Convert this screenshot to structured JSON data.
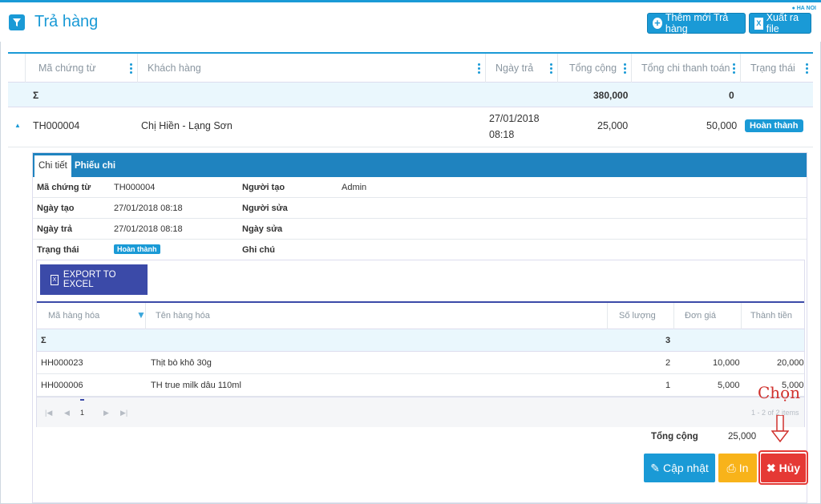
{
  "header": {
    "title": "Trả hàng",
    "location": "HA NOI",
    "add_button": "Thêm mới Trả hàng",
    "export_button": "Xuất ra file"
  },
  "grid": {
    "columns": [
      "Mã chứng từ",
      "Khách hàng",
      "Ngày trả",
      "Tổng cộng",
      "Tổng chi thanh toán",
      "Trạng thái"
    ],
    "summary": {
      "symbol": "Σ",
      "total": "380,000",
      "paid": "0"
    },
    "row": {
      "code": "TH000004",
      "customer": "Chị Hiền - Lạng Sơn",
      "date": "27/01/2018",
      "time": "08:18",
      "total": "25,000",
      "paid": "50,000",
      "status": "Hoàn thành"
    }
  },
  "detail": {
    "tabs": [
      "Chi tiết",
      "Phiếu chi"
    ],
    "info": {
      "code_label": "Mã chứng từ",
      "code": "TH000004",
      "creator_label": "Người tạo",
      "creator": "Admin",
      "created_label": "Ngày tạo",
      "created": "27/01/2018 08:18",
      "editor_label": "Người sửa",
      "return_label": "Ngày trả",
      "return_date": "27/01/2018 08:18",
      "edited_label": "Ngày sửa",
      "status_label": "Trạng thái",
      "status": "Hoàn thành",
      "note_label": "Ghi chú"
    },
    "export_excel": "EXPORT TO EXCEL",
    "items_columns": [
      "Mã hàng hóa",
      "Tên hàng hóa",
      "Số lượng",
      "Đơn giá",
      "Thành tiền"
    ],
    "items_summary": {
      "symbol": "Σ",
      "qty": "3"
    },
    "items": [
      {
        "code": "HH000023",
        "name": "Thịt bò khô 30g",
        "qty": "2",
        "price": "10,000",
        "amount": "20,000"
      },
      {
        "code": "HH000006",
        "name": "TH true milk dâu 110ml",
        "qty": "1",
        "price": "5,000",
        "amount": "5,000"
      }
    ],
    "pager": {
      "page": "1",
      "info": "1 - 2 of 2 items"
    },
    "total_label": "Tổng cộng",
    "total_value": "25,000",
    "buttons": {
      "update": "Cập nhật",
      "print": "In",
      "cancel": "Hủy"
    }
  },
  "annotation": {
    "callout": "Chọn"
  },
  "colors": {
    "primary": "#1a9ad6",
    "excel": "#3b4aa8",
    "print": "#f8b31a",
    "cancel": "#e53935"
  }
}
